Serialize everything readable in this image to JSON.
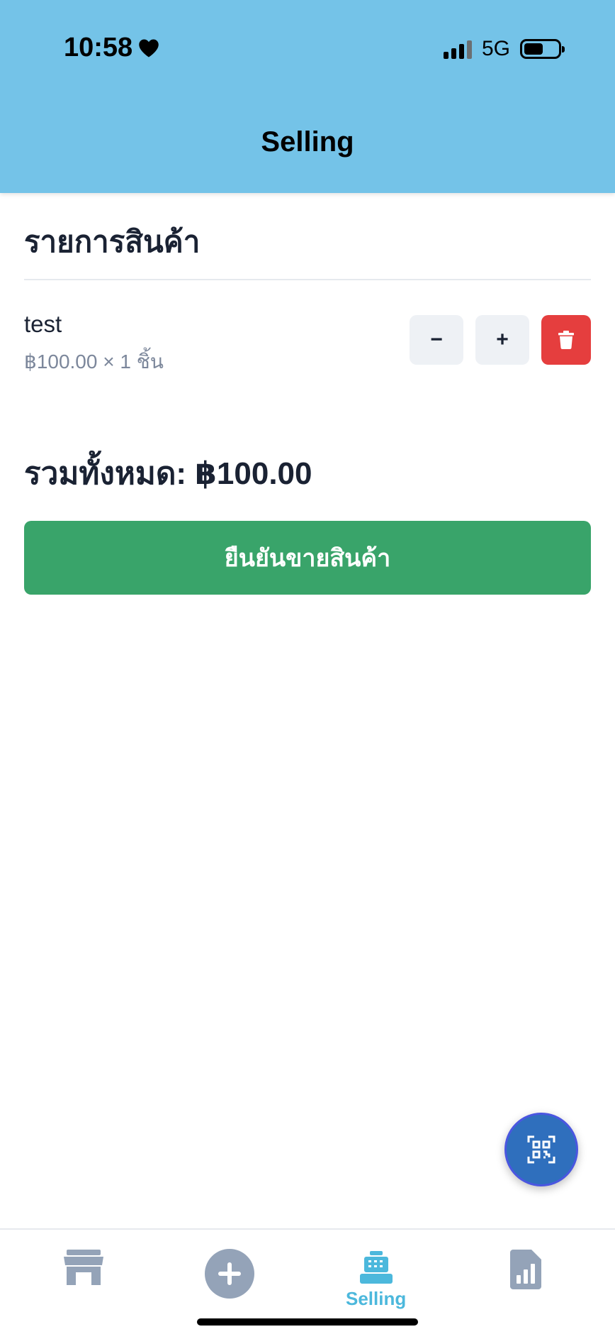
{
  "status_bar": {
    "time": "10:58",
    "network": "5G"
  },
  "header": {
    "title": "Selling"
  },
  "cart": {
    "section_title": "รายการสินค้า",
    "items": [
      {
        "name": "test",
        "detail": "฿100.00 × 1 ชิ้น",
        "minus_label": "−",
        "plus_label": "+"
      }
    ],
    "total_label": "รวมทั้งหมด: ฿100.00",
    "confirm_label": "ยืนยันขายสินค้า"
  },
  "tabbar": {
    "active": "Selling",
    "tabs": [
      {
        "icon": "store-icon"
      },
      {
        "icon": "add-circle-icon"
      },
      {
        "icon": "cash-register-icon",
        "label": "Selling"
      },
      {
        "icon": "report-chart-icon"
      }
    ]
  },
  "colors": {
    "header_bg": "#74c3e8",
    "confirm_green": "#39a46a",
    "delete_red": "#e53e3e",
    "active_tab": "#4cb8dc",
    "inactive_tab": "#94a3b8",
    "fab_blue": "#2f6fbd"
  }
}
